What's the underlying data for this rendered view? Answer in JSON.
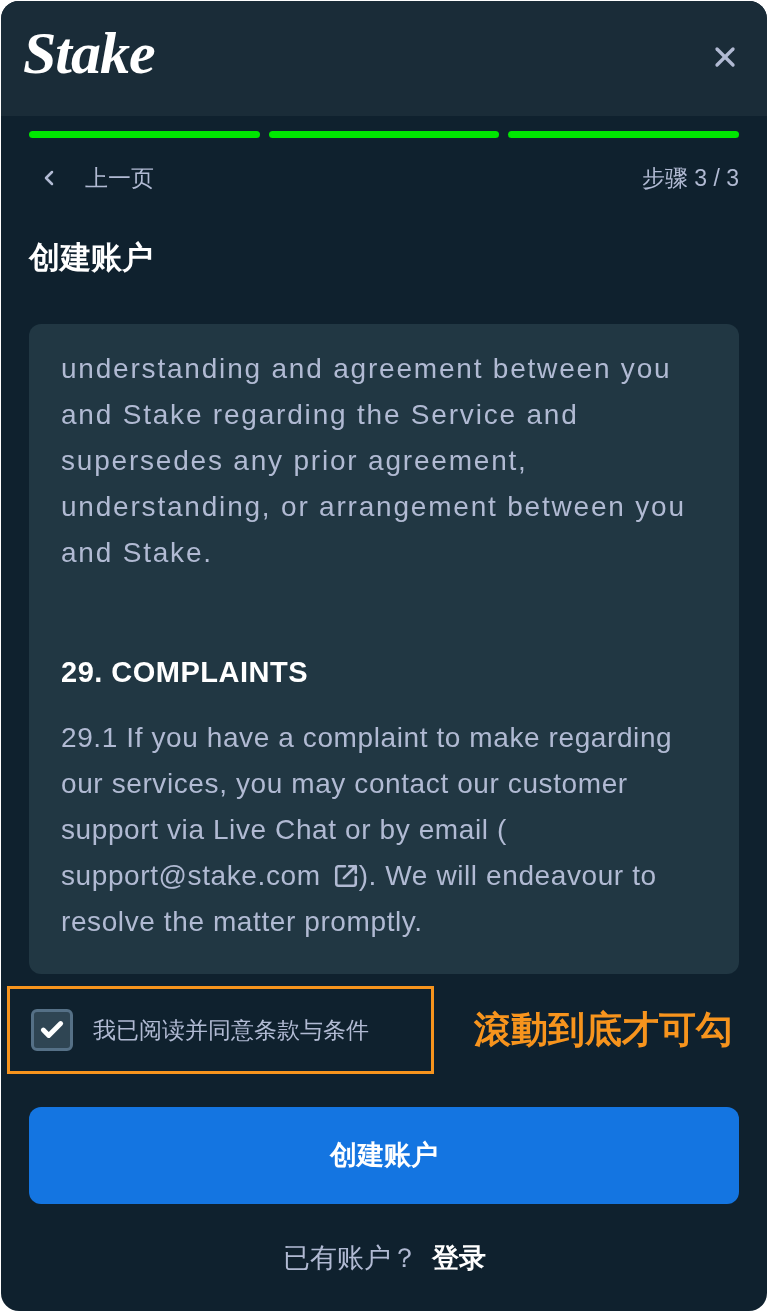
{
  "header": {
    "logo": "Stake"
  },
  "progress": {
    "segments": [
      {
        "complete": true
      },
      {
        "complete": true
      },
      {
        "complete": true
      }
    ]
  },
  "nav": {
    "back": "上一页",
    "step": "步骤 3 / 3"
  },
  "title": "创建账户",
  "terms": {
    "paragraph": "understanding and agreement between you and Stake regarding the Service and supersedes any prior agreement, understanding, or arrangement between you and Stake.",
    "heading": "29. COMPLAINTS",
    "text_before": "29.1 If you have a complaint to make regarding our services, you may contact our customer support via Live Chat or by email (",
    "email": "support@stake.com",
    "text_after": "). We will endeavour to resolve the matter promptly."
  },
  "agreement": {
    "label": "我已阅读并同意条款与条件",
    "checked": true
  },
  "annotation": {
    "note": "滾動到底才可勾"
  },
  "submit": "创建账户",
  "footer": {
    "prompt": "已有账户？",
    "link": "登录"
  }
}
